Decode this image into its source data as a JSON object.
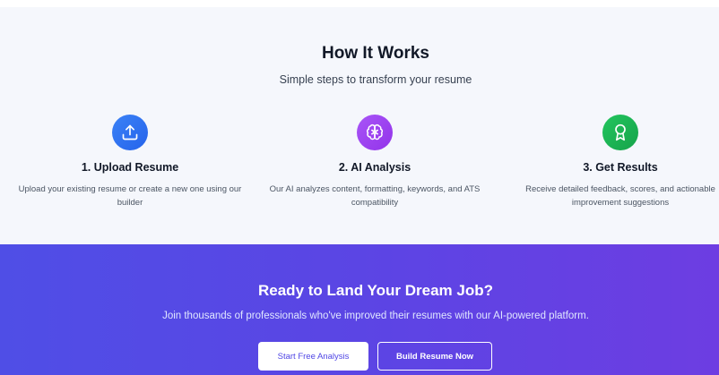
{
  "how_it_works": {
    "title": "How It Works",
    "subtitle": "Simple steps to transform your resume",
    "steps": [
      {
        "icon": "upload-icon",
        "color": "#2563eb",
        "title": "1. Upload Resume",
        "description": "Upload your existing resume or create a new one using our builder"
      },
      {
        "icon": "brain-icon",
        "color": "#9333ea",
        "title": "2. AI Analysis",
        "description": "Our AI analyzes content, formatting, keywords, and ATS compatibility"
      },
      {
        "icon": "award-icon",
        "color": "#16a34a",
        "title": "3. Get Results",
        "description": "Receive detailed feedback, scores, and actionable improvement suggestions"
      }
    ]
  },
  "cta": {
    "title": "Ready to Land Your Dream Job?",
    "subtitle": "Join thousands of professionals who've improved their resumes with our AI-powered platform.",
    "primary_button": "Start Free Analysis",
    "secondary_button": "Build Resume Now",
    "gradient_start": "#4f4ee6",
    "gradient_end": "#6d3de2"
  }
}
